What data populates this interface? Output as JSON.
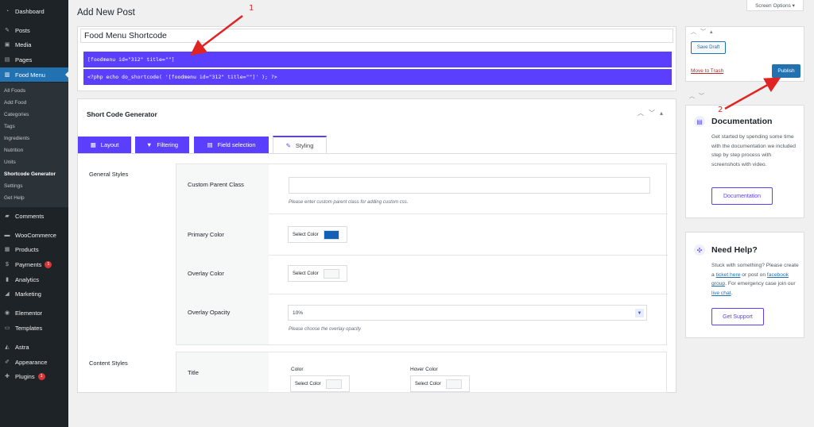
{
  "sidebar": {
    "items": [
      {
        "label": "Dashboard",
        "icon": "dashboard-icon"
      },
      {
        "label": "Posts",
        "icon": "pin-icon"
      },
      {
        "label": "Media",
        "icon": "media-icon"
      },
      {
        "label": "Pages",
        "icon": "pages-icon"
      },
      {
        "label": "Food Menu",
        "icon": "food-menu-icon"
      },
      {
        "label": "Comments",
        "icon": "comments-icon"
      },
      {
        "label": "WooCommerce",
        "icon": "woocommerce-icon"
      },
      {
        "label": "Products",
        "icon": "products-icon"
      },
      {
        "label": "Payments",
        "icon": "payments-icon",
        "badge": "1"
      },
      {
        "label": "Analytics",
        "icon": "analytics-icon"
      },
      {
        "label": "Marketing",
        "icon": "marketing-icon"
      },
      {
        "label": "Elementor",
        "icon": "elementor-icon"
      },
      {
        "label": "Templates",
        "icon": "templates-icon"
      },
      {
        "label": "Astra",
        "icon": "astra-icon"
      },
      {
        "label": "Appearance",
        "icon": "appearance-icon"
      },
      {
        "label": "Plugins",
        "icon": "plugins-icon",
        "badge": "1"
      }
    ],
    "submenu": [
      "All Foods",
      "Add Food",
      "Categories",
      "Tags",
      "Ingredients",
      "Nutrition",
      "Units",
      "Shortcode Generator",
      "Settings",
      "Get Help"
    ]
  },
  "header": {
    "title": "Add New Post",
    "screen_options": "Screen Options ▾"
  },
  "post": {
    "title": "Food Menu Shortcode",
    "shortcode": "[foodmenu id=\"312\" title=\"\"]",
    "php_code": "<?php echo do_shortcode( '[foodmenu id=\"312\" title=\"\"]' ); ?>"
  },
  "generator": {
    "title": "Short Code Generator",
    "tabs": [
      "Layout",
      "Filtering",
      "Field selection",
      "Styling"
    ],
    "active_tab": "Styling",
    "general_styles": {
      "label": "General Styles",
      "custom_parent_class": {
        "label": "Custom Parent Class",
        "value": "",
        "hint": "Please enter custom parent class for adding custom css."
      },
      "primary_color": {
        "label": "Primary Color",
        "button": "Select Color",
        "swatch": "#1060b8"
      },
      "overlay_color": {
        "label": "Overlay Color",
        "button": "Select Color",
        "swatch": "#f6f7f7"
      },
      "overlay_opacity": {
        "label": "Overlay Opacity",
        "value": "10%",
        "hint": "Please choose the overlay opacity"
      }
    },
    "content_styles": {
      "label": "Content Styles",
      "title": {
        "label": "Title",
        "color_label": "Color",
        "hover_label": "Hover Color",
        "button": "Select Color"
      }
    }
  },
  "publish": {
    "save_draft": "Save Draft",
    "move_trash": "Move to Trash",
    "publish": "Publish"
  },
  "documentation": {
    "title": "Documentation",
    "text": "Get started by spending some time with the documentation we included step by step process with screenshots with video.",
    "button": "Documentation"
  },
  "help": {
    "title": "Need Help?",
    "text_1": "Stuck with something? Please create a ",
    "link_1": "ticket here",
    "text_2": " or post on ",
    "link_2": "facebook group",
    "text_3": ". For emergency case join our ",
    "link_3": "live chat",
    "text_4": ".",
    "button": "Get Support"
  },
  "annotations": [
    "1",
    "2"
  ],
  "colors": {
    "accent": "#5b3fff",
    "wp_blue": "#2271b1",
    "sidebar": "#1d2327",
    "arrow": "#e02424"
  }
}
